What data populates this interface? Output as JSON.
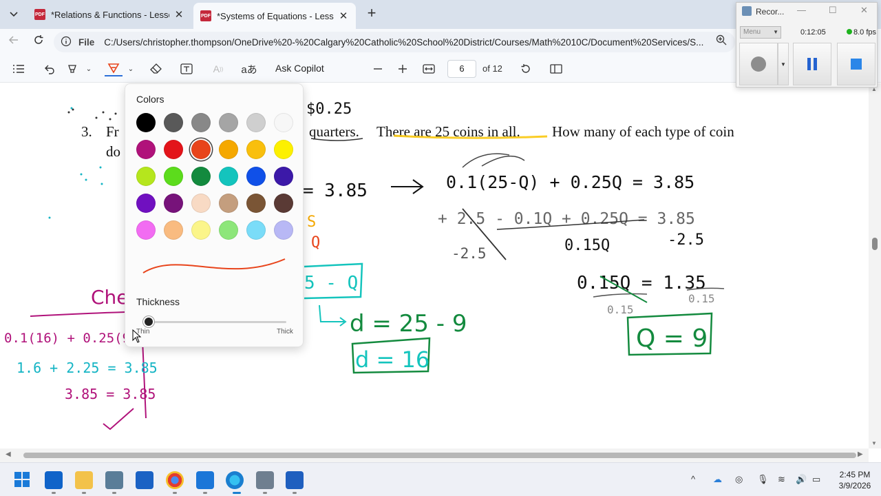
{
  "browser": {
    "tabs": [
      {
        "label": "*Relations & Functions - Lesson Bo",
        "active": false
      },
      {
        "label": "*Systems of Equations - Lesson Bo",
        "active": true
      }
    ],
    "url_scheme": "File",
    "url": "C:/Users/christopher.thompson/OneDrive%20-%20Calgary%20Catholic%20School%20District/Courses/Math%2010C/Document%20Services/S..."
  },
  "pdf_toolbar": {
    "ask_copilot": "Ask Copilot",
    "page_current": "6",
    "page_total": "of 12"
  },
  "document": {
    "problem_number": "3.",
    "problem_frag1": "Fr",
    "problem_line2_frag": "do",
    "problem_text": "quarters.",
    "problem_text2": "There are 25 coins in all.",
    "problem_text3": "How many of each type  of coin"
  },
  "annotations": {
    "top_value": "$0.25",
    "eq_main_right": "= 3.85",
    "eq_sub": "0.1(25-Q) + 0.25Q = 3.85",
    "eq_expand": "+ 2.5 - 0.1Q + 0.25Q = 3.85",
    "eq_sub_2_5": "-2.5",
    "eq_sub_2_5b": "-2.5",
    "eq_015q": "0.15Q",
    "eq_solve": "0.15Q = 1.35",
    "eq_div_left": "0.15",
    "eq_div_right": "0.15",
    "answer_q": "Q = 9",
    "d_eq_boxed": "5 - Q",
    "d_eq": "d = 25 - 9",
    "answer_d": "d = 16",
    "check_label": "Che",
    "check_line1": "0.1(16) + 0.25(9)=",
    "check_line2": "1.6 + 2.25 = 3.85",
    "check_line3": "3.85 = 3.85",
    "check_mark": "✓",
    "frag_s": "S",
    "frag_q": "Q"
  },
  "color_popup": {
    "colors_title": "Colors",
    "thickness_title": "Thickness",
    "thin_label": "Thin",
    "thick_label": "Thick",
    "selected_color": "#e8441b",
    "swatches": [
      "#000000",
      "#595959",
      "#888888",
      "#a5a5a5",
      "#cfcfcf",
      "#f7f7f7",
      "#b0127a",
      "#e3141a",
      "#e8441b",
      "#f5a800",
      "#f9bf0d",
      "#fdf000",
      "#b5e61d",
      "#5cdc1c",
      "#138a3e",
      "#14c4bd",
      "#1050e8",
      "#3c19a8",
      "#7010c0",
      "#77137a",
      "#f8dac4",
      "#c49e7e",
      "#7a5535",
      "#5a3a35",
      "#f26cf2",
      "#f9bb80",
      "#fbf58a",
      "#8de67a",
      "#7adcf8",
      "#b8b8f5"
    ]
  },
  "recorder": {
    "title": "Recor...",
    "menu": "Menu",
    "elapsed": "0:12:05",
    "fps": "8.0 fps"
  },
  "taskbar": {
    "time": "2:45 PM",
    "date": "3/9/2026"
  }
}
